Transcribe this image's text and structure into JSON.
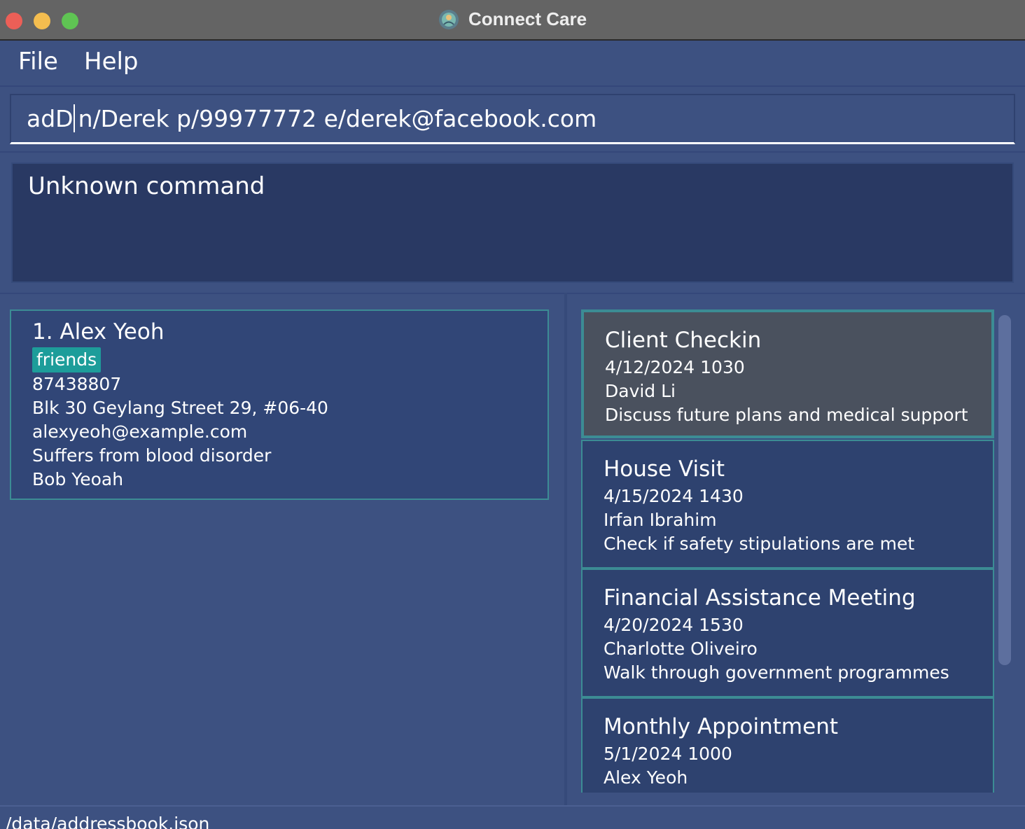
{
  "window": {
    "title": "Connect Care"
  },
  "menu": {
    "file": "File",
    "help": "Help"
  },
  "command": {
    "before_caret": "adD",
    "after_caret": "n/Derek p/99977772 e/derek@facebook.com"
  },
  "result": {
    "message": "Unknown command"
  },
  "persons": [
    {
      "index_name": "1.  Alex Yeoh",
      "tag": "friends",
      "phone": "87438807",
      "address": "Blk 30 Geylang Street 29, #06-40",
      "email": "alexyeoh@example.com",
      "medical": "Suffers from blood disorder",
      "next_of_kin": "Bob Yeoah"
    }
  ],
  "appointments": [
    {
      "title": "Client Checkin",
      "datetime": "4/12/2024 1030",
      "client": "David Li",
      "description": "Discuss future plans and medical support",
      "selected": true
    },
    {
      "title": "House Visit",
      "datetime": "4/15/2024 1430",
      "client": "Irfan Ibrahim",
      "description": "Check if safety stipulations are met"
    },
    {
      "title": "Financial Assistance Meeting",
      "datetime": "4/20/2024 1530",
      "client": "Charlotte Oliveiro",
      "description": "Walk through government programmes"
    },
    {
      "title": "Monthly Appointment",
      "datetime": "5/1/2024 1000",
      "client": "Alex Yeoh",
      "description": ""
    }
  ],
  "status": {
    "path": "/data/addressbook.json"
  },
  "colors": {
    "background": "#3d5181",
    "card_border": "#3c8c94",
    "tag": "#1d9d9a",
    "selected_card": "#4a515e"
  }
}
